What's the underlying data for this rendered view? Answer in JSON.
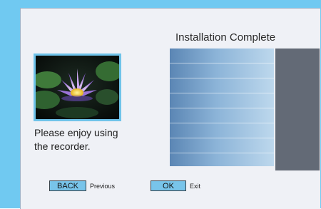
{
  "screen": {
    "title": "Installation Complete",
    "message_lines": [
      "Please enjoy using",
      "the recorder."
    ]
  },
  "thumbnail": {
    "icon": "water-lily-photo"
  },
  "footer": {
    "back_key": "BACK",
    "back_label": "Previous",
    "ok_key": "OK",
    "ok_label": "Exit"
  },
  "colors": {
    "frame": "#70c9f1",
    "panel": "#eff1f6",
    "key_fill": "#78c4ea",
    "dark_box": "#636a76"
  }
}
